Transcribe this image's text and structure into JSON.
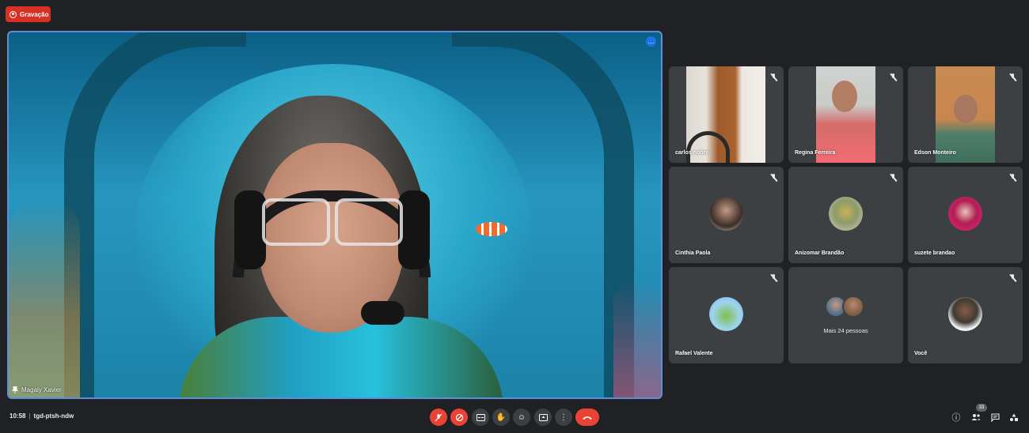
{
  "recording": {
    "label": "Gravação"
  },
  "main_video": {
    "speaker_name": "Magaly Xavier",
    "more_options_icon": "more-horiz-icon"
  },
  "participants": [
    {
      "name": "carlos nobre",
      "muted": true,
      "type": "camera"
    },
    {
      "name": "Regina Ferreira",
      "muted": true,
      "type": "camera"
    },
    {
      "name": "Edson Monteiro",
      "muted": true,
      "type": "camera"
    },
    {
      "name": "Cinthia Paola",
      "muted": true,
      "type": "avatar"
    },
    {
      "name": "Anizomar Brandão",
      "muted": true,
      "type": "avatar"
    },
    {
      "name": "suzete brandao",
      "muted": true,
      "type": "avatar"
    },
    {
      "name": "Rafael Valente",
      "muted": true,
      "type": "avatar"
    },
    {
      "name": "Você",
      "muted": true,
      "type": "avatar"
    }
  ],
  "overflow_tile": {
    "label": "Mais 24 pessoas"
  },
  "footer": {
    "time": "10:58",
    "meeting_code": "tgd-ptsh-ndw",
    "participant_count": "33",
    "controls": [
      "mic-off-icon",
      "camera-off-icon",
      "captions-icon",
      "raise-hand-icon",
      "emoji-icon",
      "present-screen-icon",
      "more-vert-icon",
      "hang-up-icon"
    ],
    "right_icons": [
      "info-icon",
      "people-icon",
      "chat-icon",
      "activities-icon"
    ]
  },
  "colors": {
    "background": "#202124",
    "tile": "#3c4043",
    "recording_red": "#d93025",
    "hangup_red": "#ea4335",
    "active_speaker_border": "#5d8fd9"
  }
}
